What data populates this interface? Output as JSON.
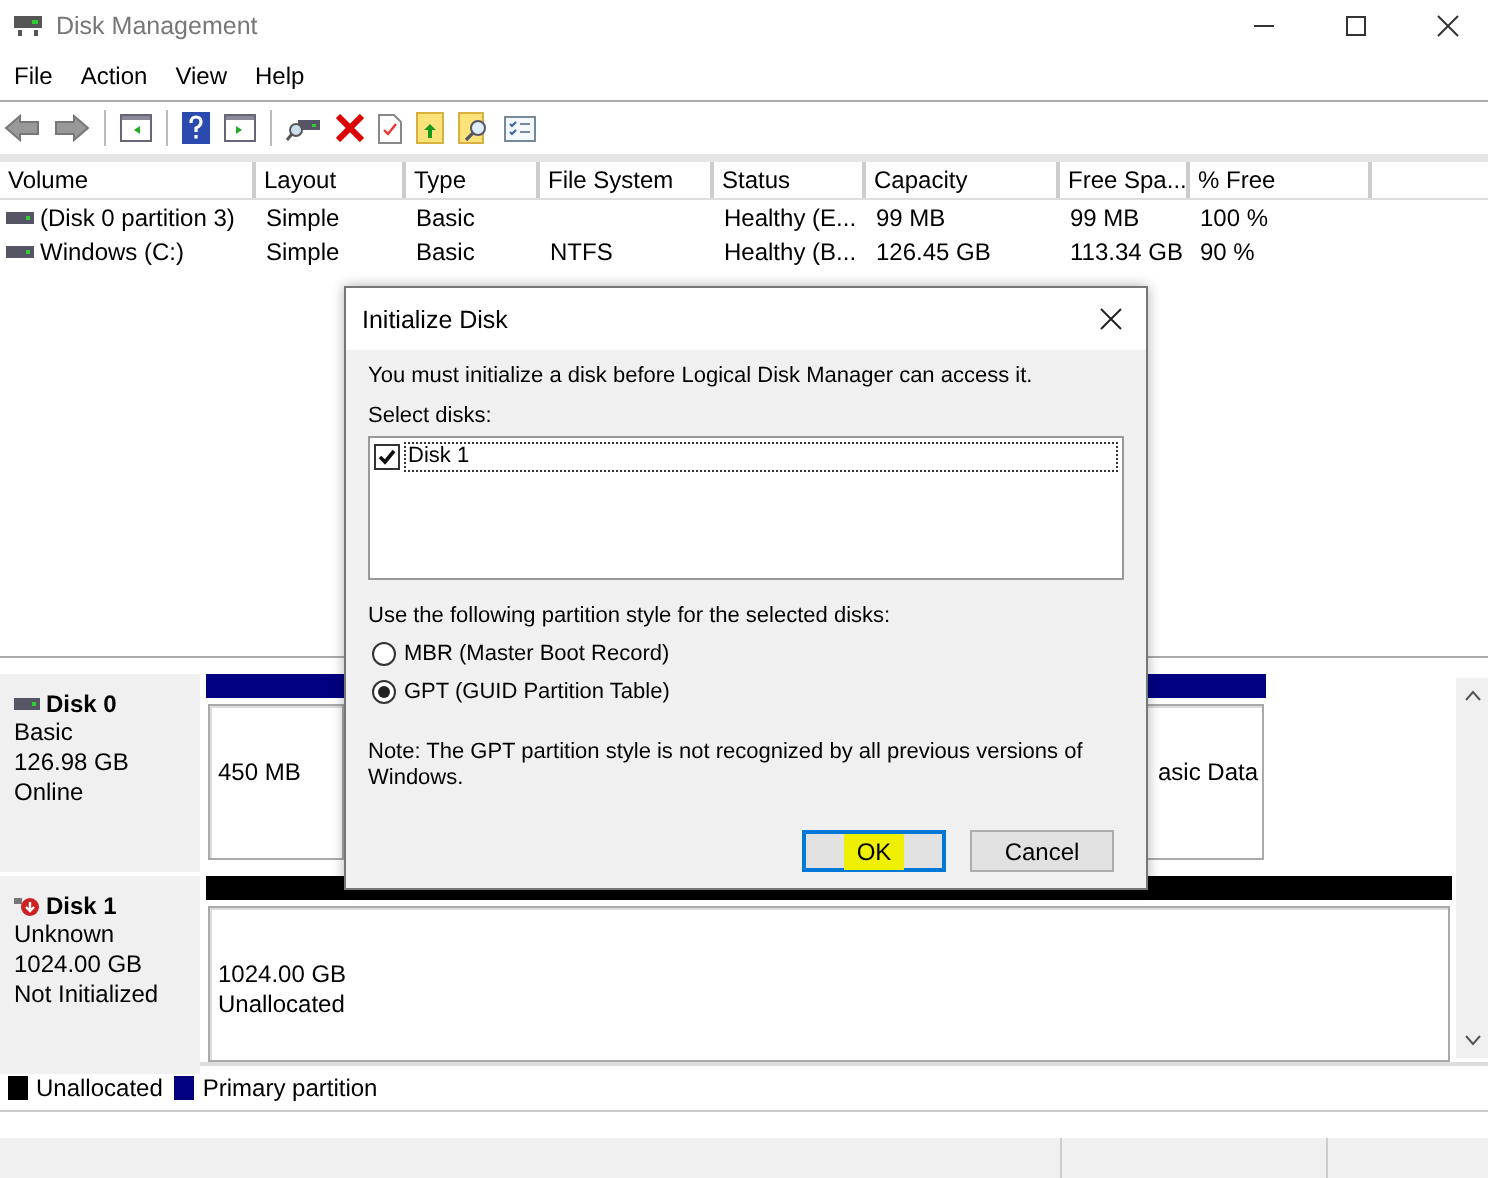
{
  "window": {
    "title": "Disk Management"
  },
  "menu": [
    {
      "label": "File"
    },
    {
      "label": "Action"
    },
    {
      "label": "View"
    },
    {
      "label": "Help"
    }
  ],
  "volumes": {
    "columns": [
      "Volume",
      "Layout",
      "Type",
      "File System",
      "Status",
      "Capacity",
      "Free Spa...",
      "% Free"
    ],
    "rows": [
      {
        "cells": [
          "(Disk 0 partition 3)",
          "Simple",
          "Basic",
          "",
          "Healthy (E...",
          "99 MB",
          "99 MB",
          "100 %"
        ]
      },
      {
        "cells": [
          "Windows (C:)",
          "Simple",
          "Basic",
          "NTFS",
          "Healthy (B...",
          "126.45 GB",
          "113.34 GB",
          "90 %"
        ]
      }
    ]
  },
  "disks": [
    {
      "name": "Disk 0",
      "kind": "online",
      "details": [
        "Basic",
        "126.98 GB",
        "Online"
      ],
      "partitions": [
        {
          "kind": "primary",
          "lines": [
            "450 MB"
          ]
        },
        {
          "kind": "primary",
          "lines": [
            "asic Data"
          ]
        }
      ]
    },
    {
      "name": "Disk 1",
      "kind": "not_initialized",
      "details": [
        "Unknown",
        "1024.00 GB",
        "Not Initialized"
      ],
      "partitions": [
        {
          "kind": "unallocated",
          "lines": [
            "1024.00 GB",
            "Unallocated"
          ]
        }
      ]
    }
  ],
  "legend": [
    {
      "label": "Unallocated",
      "color": "#000000"
    },
    {
      "label": "Primary partition",
      "color": "#000080"
    }
  ],
  "dialog": {
    "title": "Initialize Disk",
    "message": "You must initialize a disk before Logical Disk Manager can access it.",
    "select_label": "Select disks:",
    "disks": [
      {
        "label": "Disk 1",
        "checked": true,
        "selected": true
      }
    ],
    "style_label": "Use the following partition style for the selected disks:",
    "styles": [
      {
        "label": "MBR (Master Boot Record)",
        "selected": false
      },
      {
        "label": "GPT (GUID Partition Table)",
        "selected": true
      }
    ],
    "note": "Note: The GPT partition style is not recognized by all previous versions of Windows.",
    "buttons": [
      {
        "label": "OK",
        "kind": "default",
        "highlighted": true
      },
      {
        "label": "Cancel",
        "kind": "normal",
        "highlighted": false
      }
    ]
  }
}
